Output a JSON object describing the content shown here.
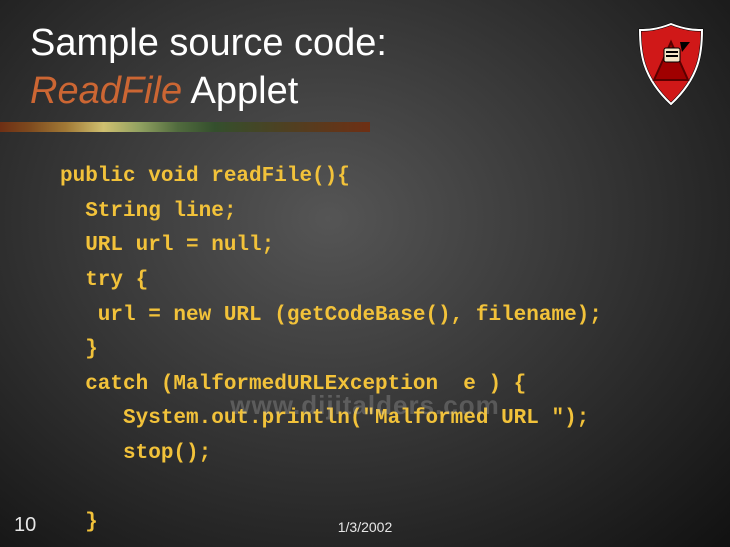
{
  "title": {
    "line1": "Sample source code:",
    "emphasis": "ReadFile",
    "line2_suffix": " Applet"
  },
  "code_lines": [
    "public void readFile(){",
    "  String line;",
    "  URL url = null;",
    "  try {",
    "   url = new URL (getCodeBase(), filename);",
    "  }",
    "  catch (MalformedURLException  e ) {",
    "     System.out.println(\"Malformed URL \");",
    "     stop();",
    "",
    "  }"
  ],
  "watermark": "www.dijitalders.com",
  "page_number": "10",
  "date": "1/3/2002"
}
